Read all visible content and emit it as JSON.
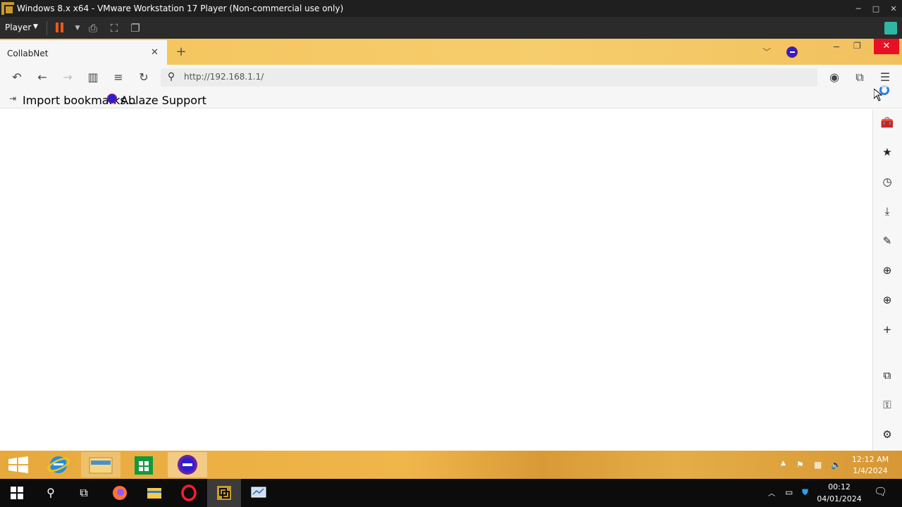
{
  "vmware": {
    "title": "Windows 8.x x64 - VMware Workstation 17 Player (Non-commercial use only)",
    "player_menu": "Player",
    "window_controls": {
      "minimize": "─",
      "maximize": "□",
      "close": "✕"
    }
  },
  "browser": {
    "tab_title": "CollabNet",
    "tab_close": "✕",
    "new_tab": "+",
    "address_url": "http://192.168.1.1/",
    "bookmarks": [
      {
        "label": "Import bookmarks...",
        "icon": "import-icon"
      },
      {
        "label": "Ablaze Support",
        "icon": "ablaze-logo"
      }
    ],
    "nav_icons": [
      "undo-icon",
      "back-icon",
      "forward-icon",
      "reader-icon",
      "menu-list-icon",
      "reload-icon"
    ],
    "toolbar_right_icons": [
      "account-icon",
      "extensions-icon",
      "hamburger-menu-icon"
    ],
    "sidebar_icons": [
      "toolbox-icon",
      "star-icon",
      "history-icon",
      "download-icon",
      "pencil-icon",
      "globe-icon",
      "globe-icon",
      "plus-icon",
      "extensions-icon",
      "key-icon",
      "gear-icon"
    ]
  },
  "guest_taskbar": {
    "apps": [
      "start-icon",
      "internet-explorer-icon",
      "file-explorer-icon",
      "store-icon",
      "ablaze-browser-icon"
    ],
    "clock_time": "12:12 AM",
    "clock_date": "1/4/2024"
  },
  "host_taskbar": {
    "apps": [
      "windows-start-icon",
      "search-icon",
      "task-view-icon",
      "firefox-icon",
      "file-explorer-icon",
      "opera-icon",
      "vmware-icon",
      "monitor-icon"
    ],
    "clock_time": "00:12",
    "clock_date": "04/01/2024"
  },
  "colors": {
    "tab_accent": "#f3c35b",
    "close_red": "#e81123",
    "vmware_pause": "#e85a19"
  }
}
